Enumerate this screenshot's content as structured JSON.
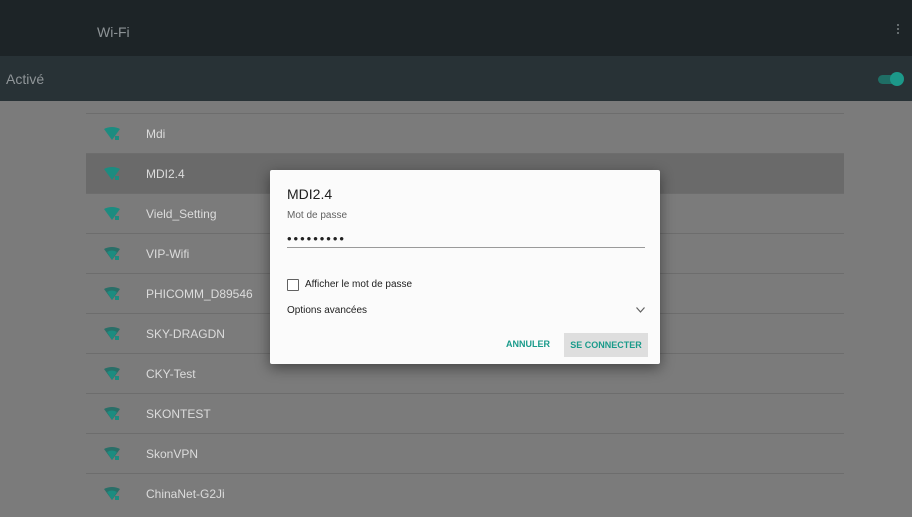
{
  "header": {
    "title": "Wi-Fi"
  },
  "switch": {
    "label": "Activé",
    "state": "on"
  },
  "networks": [
    {
      "ssid": "Mdi"
    },
    {
      "ssid": "MDI2.4"
    },
    {
      "ssid": "Vield_Setting"
    },
    {
      "ssid": "VIP-Wifi"
    },
    {
      "ssid": "PHICOMM_D89546"
    },
    {
      "ssid": "SKY-DRAGDN"
    },
    {
      "ssid": "CKY-Test"
    },
    {
      "ssid": "SKONTEST"
    },
    {
      "ssid": "SkonVPN"
    },
    {
      "ssid": "ChinaNet-G2Ji"
    }
  ],
  "dialog": {
    "title": "MDI2.4",
    "password_label": "Mot de passe",
    "password_value": "•••••••••",
    "show_password_label": "Afficher le mot de passe",
    "show_password_checked": false,
    "advanced_label": "Options avancées",
    "cancel_label": "ANNULER",
    "connect_label": "SE CONNECTER"
  },
  "colors": {
    "accent": "#1a9b8b",
    "topbar": "#1d2427",
    "switchbar": "#283236",
    "wifi_icon": "#1c8c80"
  },
  "icons": {
    "wifi": "wifi-locked-icon",
    "menu": "more-vert-icon",
    "expand": "chevron-down-icon"
  }
}
